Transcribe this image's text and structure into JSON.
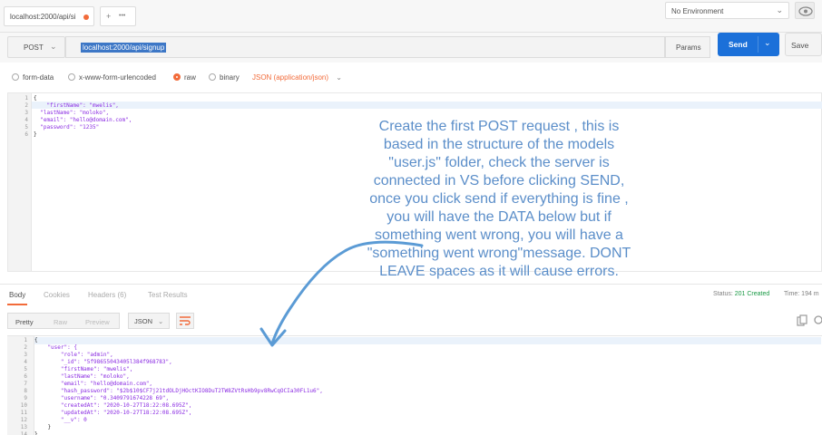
{
  "tab": {
    "title": "localhost:2000/api/si"
  },
  "tab_add": {
    "plus": "+",
    "more": "•••"
  },
  "environment": {
    "selected": "No Environment"
  },
  "request": {
    "method": "POST",
    "url": "localhost:2000/api/signup",
    "params_label": "Params",
    "send_label": "Send",
    "save_label": "Save"
  },
  "body_types": {
    "form_data": "form-data",
    "urlencoded": "x-www-form-urlencoded",
    "raw": "raw",
    "binary": "binary",
    "content_type": "JSON (application/json)"
  },
  "request_body": {
    "line_numbers": [
      "1",
      "2",
      "3",
      "4",
      "5",
      "6"
    ],
    "lines": [
      "{",
      "    \"firstName\": \"mwelis\",",
      "  \"lastName\": \"moloko\",",
      "  \"email\": \"hello@domain.com\",",
      "  \"password\": \"1235\"",
      "}"
    ]
  },
  "annotation": {
    "text": "Create the first POST request , this is based in the structure of the models \"user.js\" folder, check the server is connected in VS before clicking SEND, once you click send if everything is fine , you will have the DATA below but if something went wrong, you will have a \"something went wrong\"message. DONT LEAVE spaces as it will cause errors."
  },
  "response_tabs": {
    "body": "Body",
    "cookies": "Cookies",
    "headers": "Headers (6)",
    "test_results": "Test Results",
    "status_label": "Status:",
    "status_value": "201 Created",
    "time": "Time: 194 m"
  },
  "response_view": {
    "pretty": "Pretty",
    "raw": "Raw",
    "preview": "Preview",
    "format": "JSON"
  },
  "response_body": {
    "line_numbers": [
      "1",
      "2",
      "3",
      "4",
      "5",
      "6",
      "7",
      "8",
      "9",
      "10",
      "11",
      "12",
      "13",
      "14"
    ],
    "lines": [
      "{",
      "    \"user\": {",
      "        \"role\": \"admin\",",
      "        \"_id\": \"5f98655043405l384f968783\",",
      "        \"firstName\": \"mwelis\",",
      "        \"lastName\": \"moloko\",",
      "        \"email\": \"hello@domain.com\",",
      "        \"hash_password\": \"$2b$10$CF7j21tdOLDjHOctKIO8DuT2TW8ZVtRsHb9pv8RwCqOCIa30FL1u6\",",
      "        \"username\": \"0.3409791674228 69\",",
      "        \"createdAt\": \"2020-10-27T18:22:08.695Z\",",
      "        \"updatedAt\": \"2020-10-27T18:22:08.695Z\",",
      "        \"__v\": 0",
      "    }",
      "}"
    ]
  },
  "colors": {
    "accent": "#f26b3a",
    "send": "#1b70d9",
    "annotation": "#5b8ec9",
    "status_ok": "#1a9a45"
  }
}
